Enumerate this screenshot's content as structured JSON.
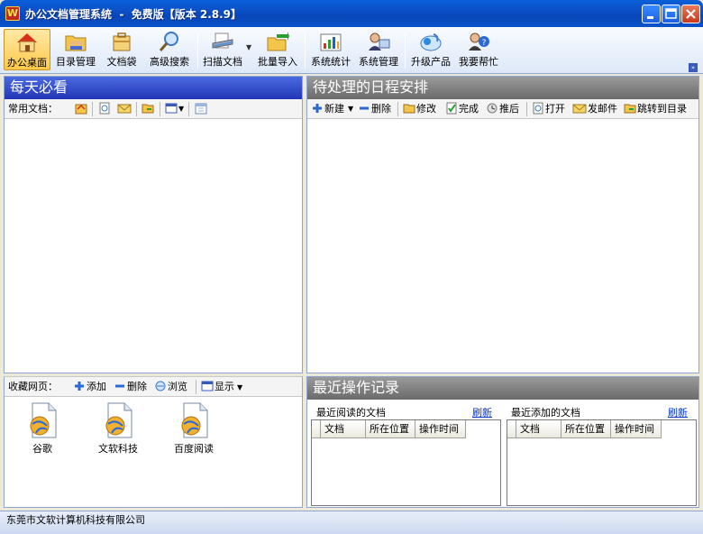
{
  "window": {
    "title": "办公文档管理系统  -  免费版【版本 2.8.9】",
    "app_icon": "W"
  },
  "toolbar": {
    "items": [
      {
        "label": "办公桌面",
        "icon": "home-icon",
        "active": true
      },
      {
        "label": "目录管理",
        "icon": "folder-users-icon"
      },
      {
        "label": "文档袋",
        "icon": "document-bag-icon"
      },
      {
        "label": "高级搜索",
        "icon": "magnifier-icon"
      },
      {
        "label": "扫描文档",
        "icon": "scanner-icon"
      },
      {
        "label": "批量导入",
        "icon": "batch-import-icon"
      },
      {
        "label": "系统统计",
        "icon": "bar-chart-icon"
      },
      {
        "label": "系统管理",
        "icon": "admin-icon"
      },
      {
        "label": "升级产品",
        "icon": "upgrade-icon"
      },
      {
        "label": "我要帮忙",
        "icon": "help-icon"
      }
    ]
  },
  "daily": {
    "title": "每天必看",
    "common_docs_label": "常用文档："
  },
  "schedule": {
    "title": "待处理的日程安排",
    "actions": {
      "new": "新建",
      "delete": "删除",
      "edit": "修改",
      "done": "完成",
      "postpone": "推后",
      "open": "打开",
      "send_mail": "发邮件",
      "goto_dir": "跳转到目录"
    }
  },
  "bookmarks": {
    "label": "收藏网页：",
    "add": "添加",
    "delete": "删除",
    "browse": "浏览",
    "display": "显示",
    "items": [
      "谷歌",
      "文软科技",
      "百度阅读"
    ]
  },
  "recent": {
    "title": "最近操作记录",
    "read_title": "最近阅读的文档",
    "added_title": "最近添加的文档",
    "refresh": "刷新",
    "columns": [
      "文档",
      "所在位置",
      "操作时间"
    ]
  },
  "statusbar": {
    "company": "东莞市文软计算机科技有限公司"
  },
  "colors": {
    "panel_head_blue": "#2236b8",
    "panel_head_gray": "#6a6a6a",
    "title_bar": "#0a53c9",
    "active_tab": "#ffc94a"
  }
}
